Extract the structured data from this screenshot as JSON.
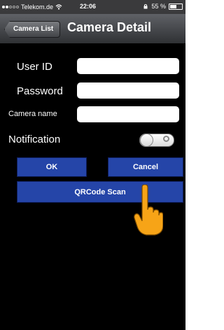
{
  "status_bar": {
    "carrier": "Telekom.de",
    "time": "22:06",
    "battery_percent": "55 %",
    "battery_level": 0.55
  },
  "nav": {
    "back_label": "Camera List",
    "title": "Camera Detail"
  },
  "form": {
    "user_id_label": "User ID",
    "user_id_value": "",
    "password_label": "Password",
    "password_value": "",
    "camera_name_label": "Camera name",
    "camera_name_value": "",
    "notification_label": "Notification",
    "notification_on": false
  },
  "buttons": {
    "ok_label": "OK",
    "cancel_label": "Cancel",
    "qrcode_label": "QRCode Scan"
  },
  "colors": {
    "button_blue": "#2545a8",
    "background": "#000000",
    "hand": "#f7a417"
  }
}
